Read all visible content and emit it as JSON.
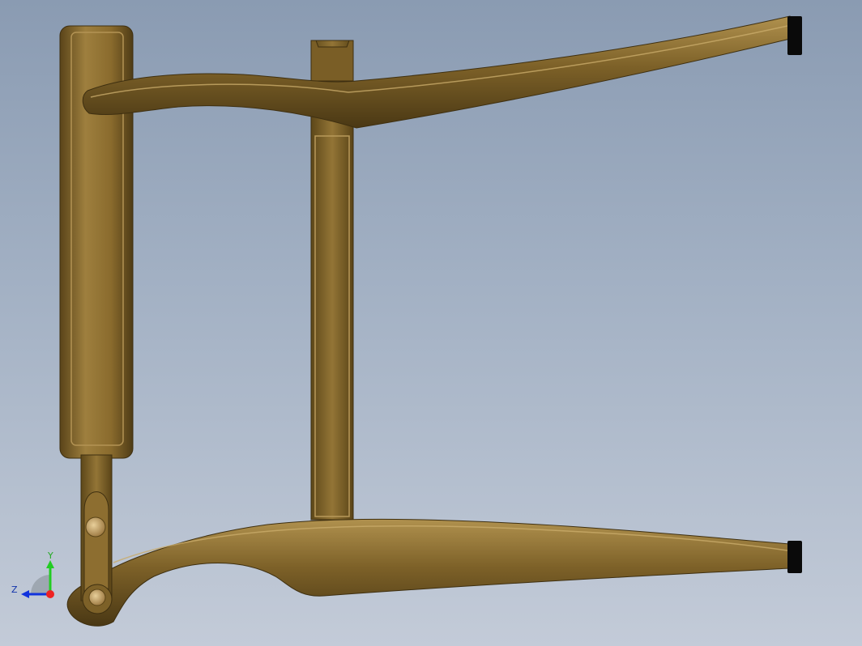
{
  "viewport": {
    "background_top": "#8a9bb2",
    "background_bottom": "#c3cbd8"
  },
  "model": {
    "color": "#8a6a2c",
    "parts": [
      "top-arm",
      "bottom-arm",
      "left-frame-bar",
      "center-post",
      "hinge-link",
      "end-caps"
    ]
  },
  "triad": {
    "y_label": "Y",
    "z_label": "Z",
    "y_color": "#22cc22",
    "z_color": "#1133dd",
    "origin_color": "#ee2222"
  }
}
